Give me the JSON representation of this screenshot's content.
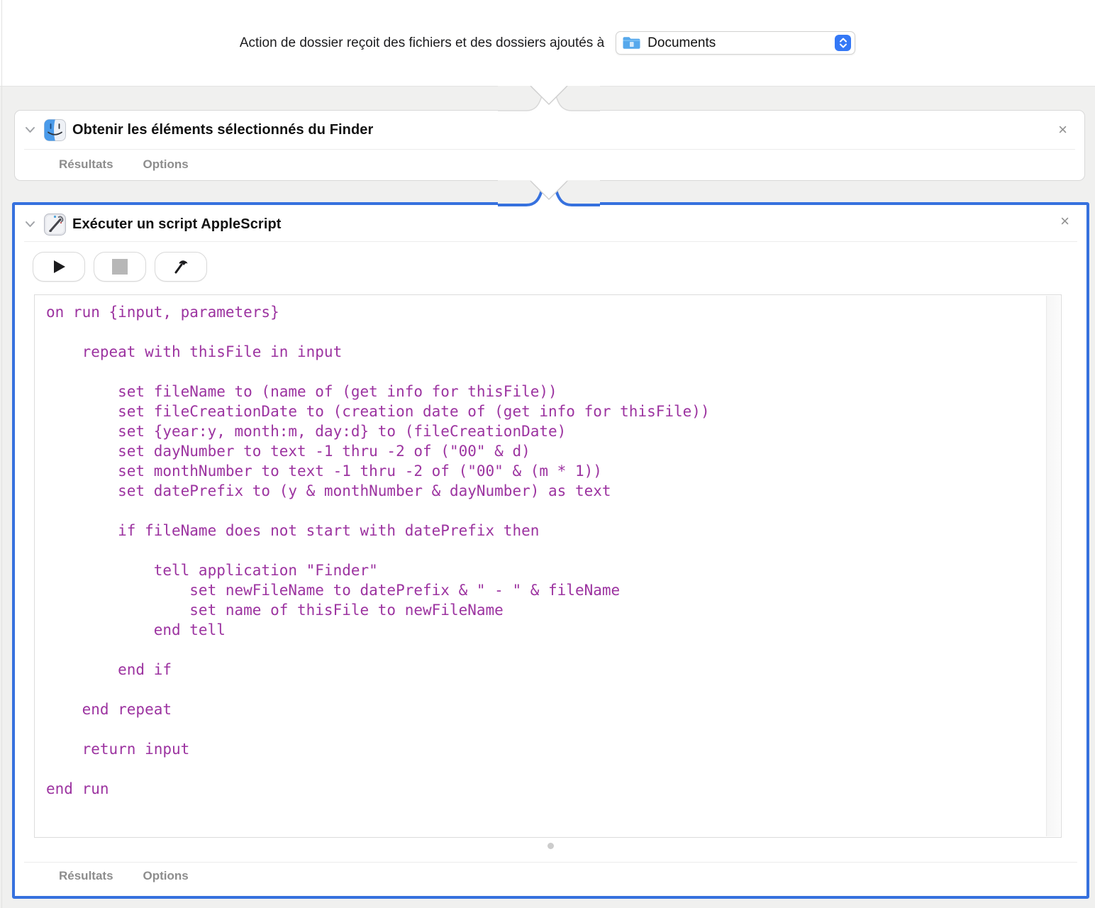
{
  "colors": {
    "selection_blue": "#3671de",
    "code_purple": "#9c33a0",
    "stepper_blue": "#3478f6",
    "background_gray": "#f0f0ef"
  },
  "top_bar": {
    "sentence": "Action de dossier reçoit des fichiers et des dossiers ajoutés à",
    "folder_popup": {
      "value": "Documents",
      "icon": "blue-folder-icon"
    }
  },
  "actions": [
    {
      "title": "Obtenir les éléments sélectionnés du Finder",
      "icon": "finder-icon",
      "links": {
        "results": "Résultats",
        "options": "Options"
      },
      "close": "×"
    },
    {
      "title": "Exécuter un script AppleScript",
      "icon": "applescript-icon",
      "toolbar": {
        "run": "play-icon",
        "stop": "stop-icon",
        "compile": "hammer-icon"
      },
      "code_lines": [
        "on run {input, parameters}",
        "",
        "    repeat with thisFile in input",
        "",
        "        set fileName to (name of (get info for thisFile))",
        "        set fileCreationDate to (creation date of (get info for thisFile))",
        "        set {year:y, month:m, day:d} to (fileCreationDate)",
        "        set dayNumber to text -1 thru -2 of (\"00\" & d)",
        "        set monthNumber to text -1 thru -2 of (\"00\" & (m * 1))",
        "        set datePrefix to (y & monthNumber & dayNumber) as text",
        "",
        "        if fileName does not start with datePrefix then",
        "",
        "            tell application \"Finder\"",
        "                set newFileName to datePrefix & \" - \" & fileName",
        "                set name of thisFile to newFileName",
        "            end tell",
        "",
        "        end if",
        "",
        "    end repeat",
        "",
        "    return input",
        "",
        "end run"
      ],
      "links": {
        "results": "Résultats",
        "options": "Options"
      },
      "close": "×"
    }
  ]
}
